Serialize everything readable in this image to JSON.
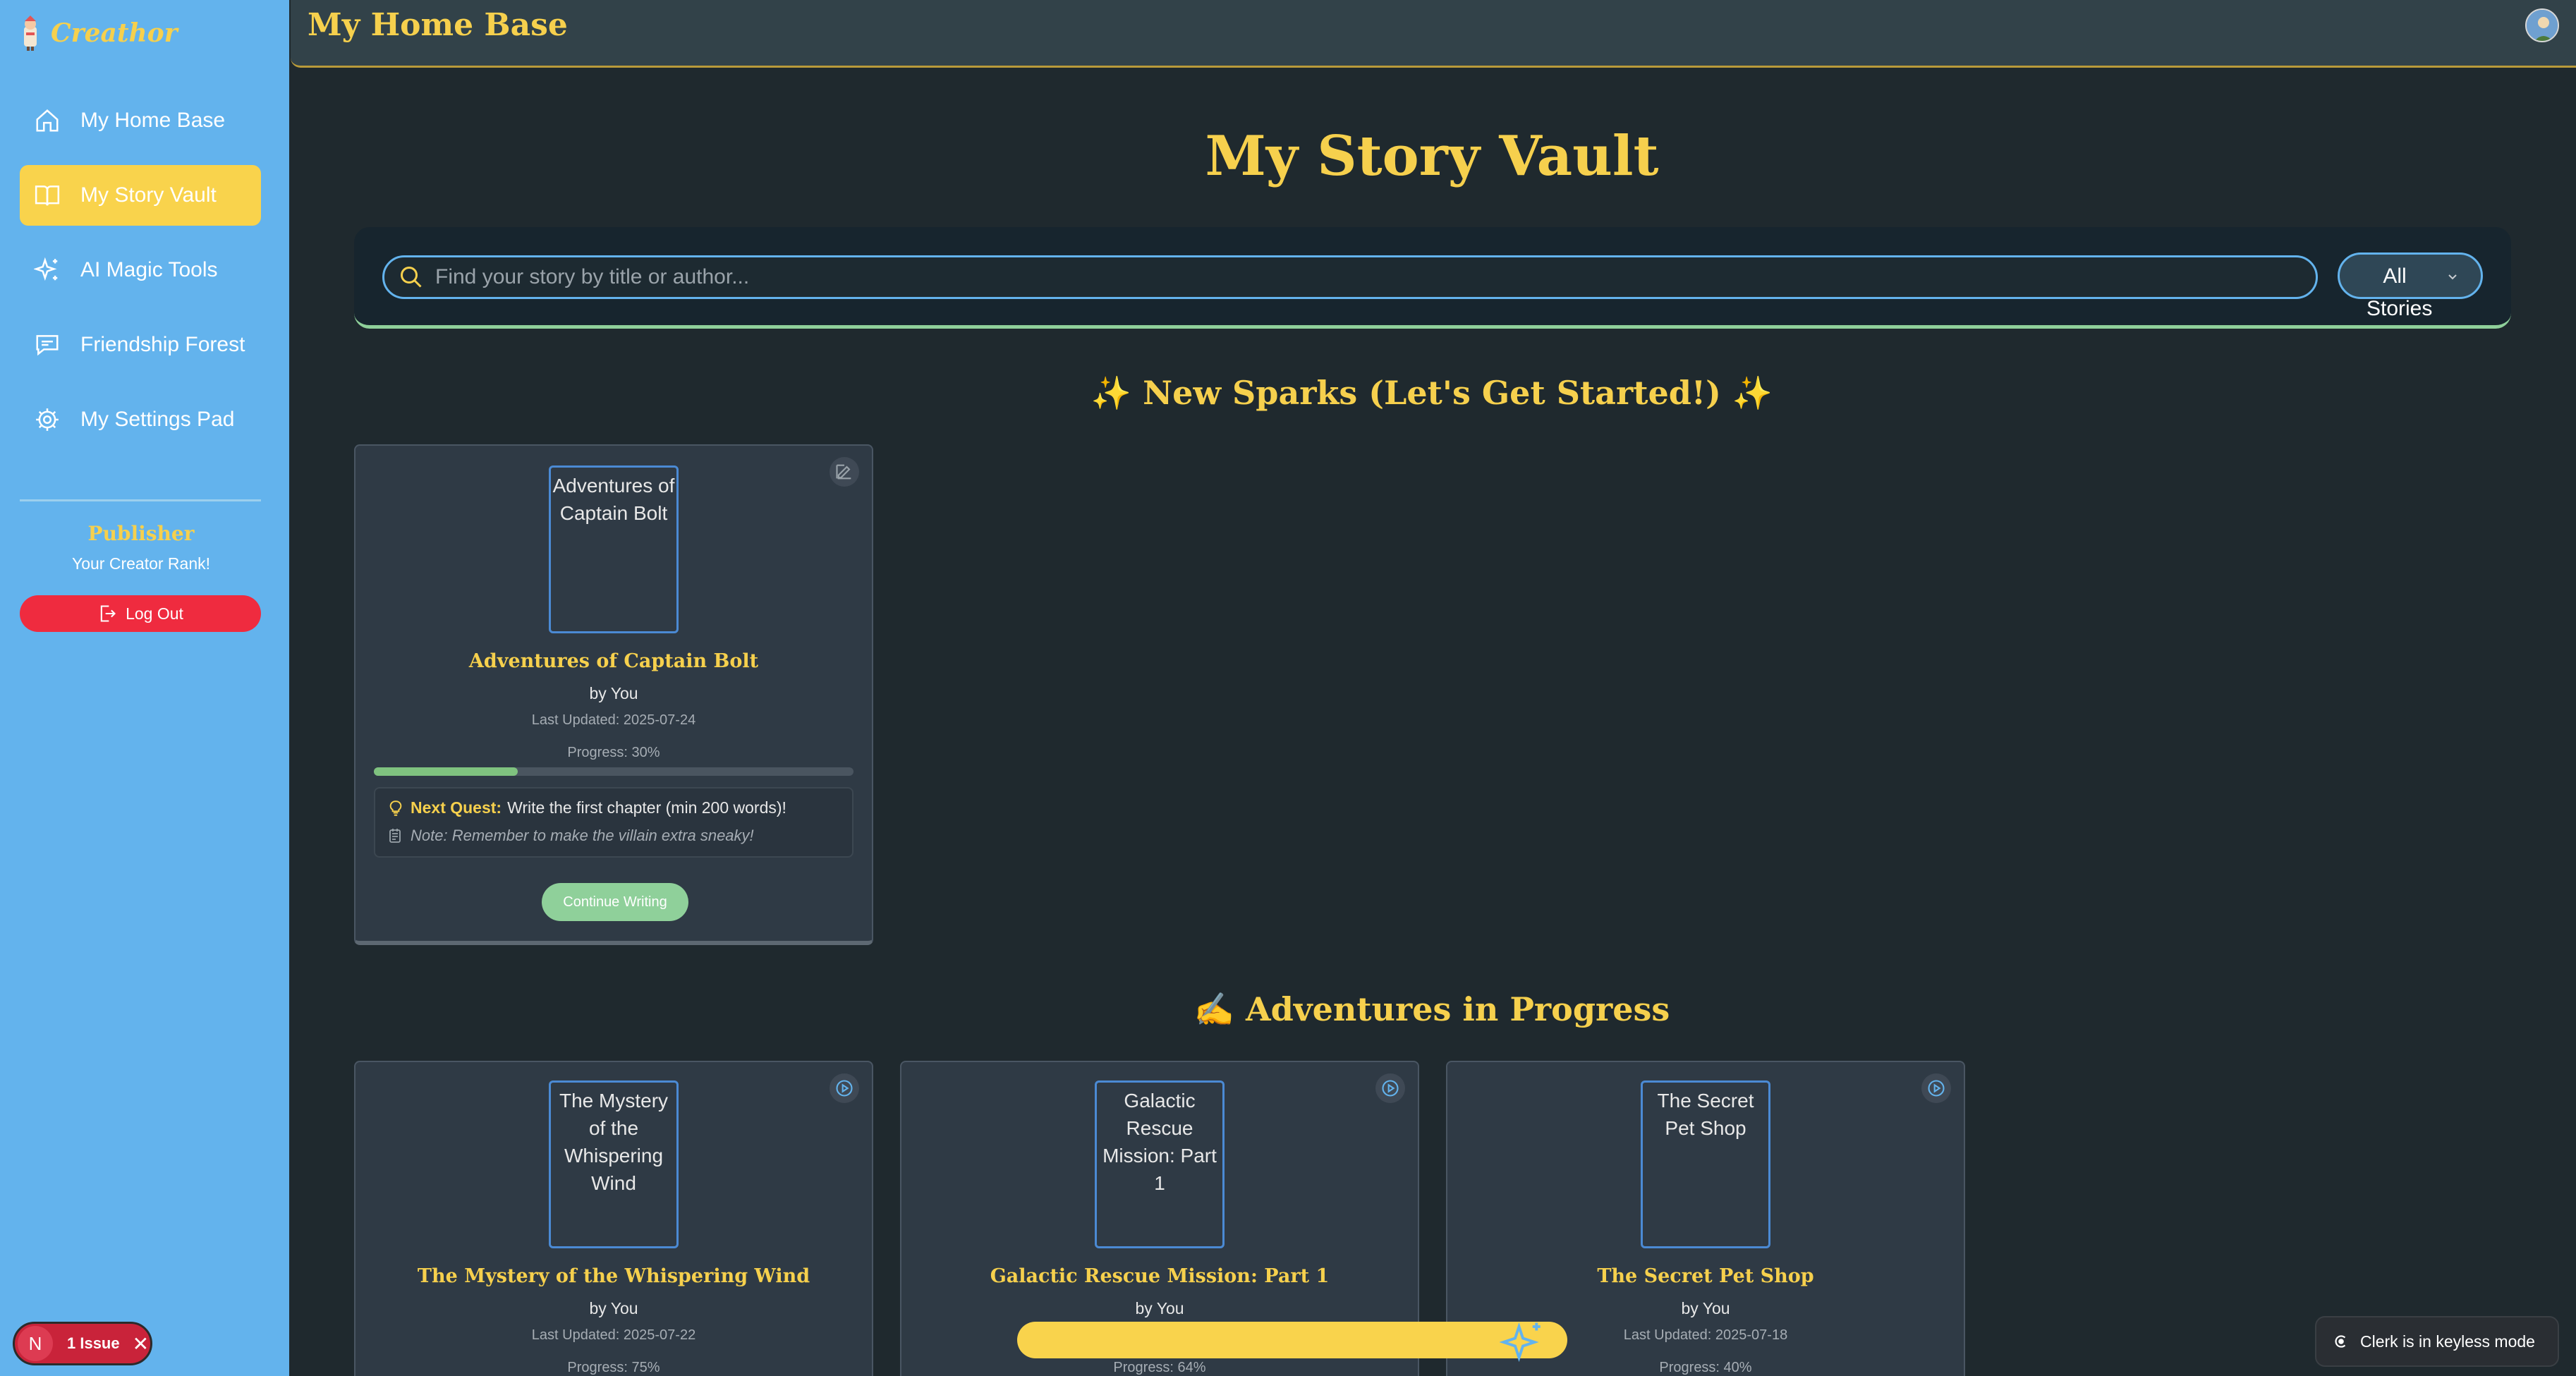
{
  "app": {
    "name": "Creathor"
  },
  "sidebar": {
    "items": [
      {
        "label": "My Home Base",
        "icon": "home-icon"
      },
      {
        "label": "My Story Vault",
        "icon": "book-icon",
        "active": true
      },
      {
        "label": "AI Magic Tools",
        "icon": "sparkles-icon"
      },
      {
        "label": "Friendship Forest",
        "icon": "chat-icon"
      },
      {
        "label": "My Settings Pad",
        "icon": "gear-icon"
      }
    ],
    "rank_title": "Publisher",
    "rank_subtitle": "Your Creator Rank!",
    "logout_label": "Log Out",
    "issue_badge": {
      "initial": "N",
      "text": "1 Issue"
    }
  },
  "header": {
    "title": "My Home Base"
  },
  "main": {
    "title": "My Story Vault",
    "search": {
      "placeholder": "Find your story by title or author...",
      "value": ""
    },
    "filter": {
      "selected": "All Stories"
    },
    "sections": [
      {
        "title": "✨ New Sparks (Let's Get Started!) ✨",
        "cards": [
          {
            "title": "Adventures of Captain Bolt",
            "cover_alt": "Adventures of Captain Bolt",
            "by": "by You",
            "last_updated": "Last Updated: 2025-07-24",
            "progress_label": "Progress: 30%",
            "progress": 0.3,
            "quest_label": "Next Quest:",
            "quest_text": "Write the first chapter (min 200 words)!",
            "note": "Note: Remember to make the villain extra sneaky!",
            "action_label": "Continue Writing",
            "corner_icon": "edit-icon"
          }
        ]
      },
      {
        "title": "✍️ Adventures in Progress",
        "cards": [
          {
            "title": "The Mystery of the Whispering Wind",
            "cover_alt": "The Mystery of the Whispering Wind",
            "by": "by You",
            "last_updated": "Last Updated: 2025-07-22",
            "progress_label": "Progress: 75%",
            "corner_icon": "play-icon"
          },
          {
            "title": "Galactic Rescue Mission: Part 1",
            "cover_alt": "Galactic Rescue Mission: Part 1",
            "by": "by You",
            "progress_label": "Progress: 64%",
            "corner_icon": "play-icon"
          },
          {
            "title": "The Secret Pet Shop",
            "cover_alt": "The Secret Pet Shop",
            "by": "by You",
            "last_updated": "Last Updated: 2025-07-18",
            "progress_label": "Progress: 40%",
            "corner_icon": "play-icon"
          }
        ]
      }
    ]
  },
  "clerk_badge": "Clerk is in keyless mode",
  "colors": {
    "sidebar": "#63b3ed",
    "accent_yellow": "#f6d04d",
    "background": "#1f292e",
    "card": "#2f3a45",
    "logout": "#ef2b3f",
    "progress": "#7fc27f"
  }
}
